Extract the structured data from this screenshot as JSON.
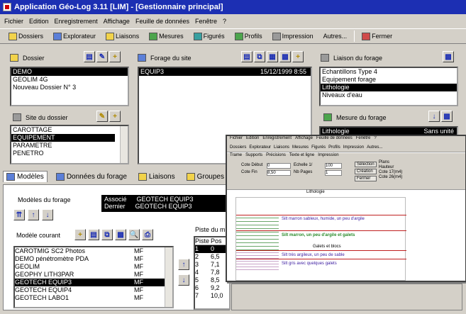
{
  "title_bar": {
    "title": "Application Géo-Log 3.11  [LIM] - [Gestionnaire principal]"
  },
  "menu": [
    "Fichier",
    "Edition",
    "Enregistrement",
    "Affichage",
    "Feuille de données",
    "Fenêtre",
    "?"
  ],
  "toolbar": [
    "Dossiers",
    "Explorateur",
    "Liaisons",
    "Mesures",
    "Figurés",
    "Profils",
    "Impression",
    "Autres...",
    "Fermer"
  ],
  "dossier": {
    "label": "Dossier",
    "items": [
      "DEMO",
      "GEOLIM 4G",
      "Nouveau Dossier N° 3"
    ],
    "selected": 0
  },
  "forage": {
    "label": "Forage du site",
    "name": "EQUIP3",
    "date": "15/12/1999 8:55"
  },
  "liaison": {
    "label": "Liaison du forage",
    "items": [
      "Echantillons Type 4",
      "Equipement forage",
      "Lithologie",
      "Niveaux d'eau"
    ],
    "selected": 2
  },
  "site": {
    "label": "Site du dossier",
    "items": [
      "CAROTTAGE",
      "EQUIPEMENT",
      "PARAMETRE",
      "PENETRO"
    ],
    "selected": 1
  },
  "mesure": {
    "label": "Mesure du forage",
    "row": {
      "name": "Lithologie",
      "unit": "Sans unité"
    }
  },
  "tabs": [
    "Modèles",
    "Données du forage",
    "Liaisons",
    "Groupes"
  ],
  "modeles": {
    "label": "Modèles du forage",
    "associe_label": "Associé",
    "associe_value": "GEOTECH EQUIP3",
    "dernier_label": "Dernier",
    "dernier_value": "GEOTECH EQUIP3",
    "courant_label": "Modèle courant",
    "items": [
      {
        "name": "CAROTMIG SC2 Photos",
        "code": "MF"
      },
      {
        "name": "DEMO pénétromètre PDA",
        "code": "MF"
      },
      {
        "name": "GEOLIM",
        "code": "MF"
      },
      {
        "name": "GEOPHY LITH3PAR",
        "code": "MF"
      },
      {
        "name": "GEOTECH EQUIP3",
        "code": "MF"
      },
      {
        "name": "GEOTECH EQUIP4",
        "code": "MF"
      },
      {
        "name": "GEOTECH LABO1",
        "code": "MF"
      }
    ],
    "selected": 4
  },
  "piste": {
    "label": "Piste du m",
    "headers": [
      "Piste",
      "Pos"
    ],
    "rows": [
      [
        "1",
        "0"
      ],
      [
        "2",
        "6,5"
      ],
      [
        "3",
        "7,1"
      ],
      [
        "4",
        "7,8"
      ],
      [
        "5",
        "8,5"
      ],
      [
        "6",
        "9,2"
      ],
      [
        "7",
        "10,0"
      ]
    ],
    "selected": 0
  },
  "inner_window": {
    "menu": [
      "Fichier",
      "Edition",
      "Enregistrement",
      "Affichage",
      "Feuille de données",
      "Fenêtre",
      "?"
    ],
    "toolbar": [
      "Dossiers",
      "Explorateur",
      "Liaisons",
      "Mesures",
      "Figurés",
      "Profils",
      "Impression",
      "Autres..."
    ],
    "tabs": [
      "Trame",
      "Supports",
      "Précisions",
      "Texte et ligne",
      "Impression"
    ],
    "cote_debut_label": "Cote Début",
    "cote_debut": "0",
    "cote_fin_label": "Cote Fin",
    "cote_fin": "8,50",
    "echelle_label": "Echelle 1/",
    "echelle": "100",
    "nb_pages_label": "Nb Pages",
    "nb_pages": "1",
    "buttons": [
      "Sélection",
      "Création",
      "Fermer"
    ],
    "right_panel": [
      "Plans",
      "Hauteur",
      "Cote 17(m4)",
      "Cote 26(m4)"
    ],
    "column_title": "Lithologie",
    "layers": [
      "Silt marron sableux, humide, un peu d'argile",
      "Silt marron, un peu d'argile et galets",
      "Galets et blocs",
      "Silt très argileux, un peu de sable",
      "Silt gris avec quelques galets"
    ]
  }
}
